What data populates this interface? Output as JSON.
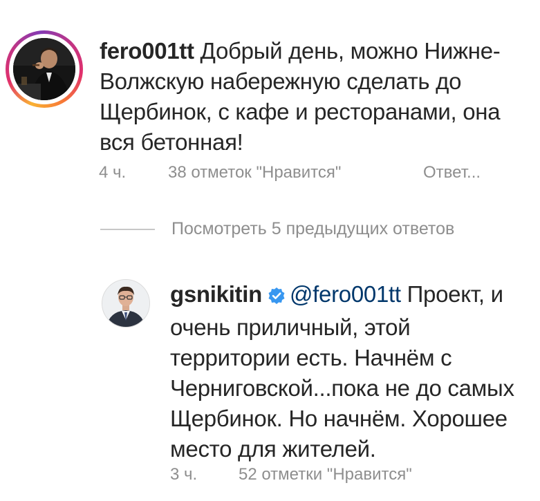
{
  "comment": {
    "username": "fero001tt",
    "text": " Добрый день,  можно Нижне-Волжскую набережную сделать до Щербинок, с кафе и ресторанами, она вся бетонная!",
    "time": "4 ч.",
    "likes": "38 отметок \"Нравится\"",
    "reply_label": "Ответ..."
  },
  "view_replies": "Посмотреть 5 предыдущих ответов",
  "reply": {
    "username": "gsnikitin",
    "verified_icon": "verified-badge-icon",
    "mention": "@fero001tt",
    "text": " Проект, и очень приличный, этой территории есть. Начнём с Черниговской...пока не до самых Щербинок. Но начнём. Хорошее место для жителей.",
    "time": "3 ч.",
    "likes": "52 отметки \"Нравится\""
  },
  "colors": {
    "text": "#262626",
    "meta": "#8e8e8e",
    "mention": "#00376b",
    "verified": "#3897f0",
    "story_ring": "#e1306c"
  }
}
